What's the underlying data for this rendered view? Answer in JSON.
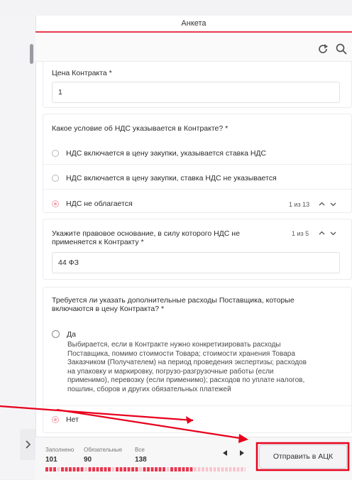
{
  "header": {
    "title": "Анкета"
  },
  "q1": {
    "label": "Цена Контракта *",
    "value": "1"
  },
  "q2": {
    "label": "Какое условие об НДС указывается в Контракте? *",
    "options": [
      "НДС включается в цену закупки, указывается ставка НДС",
      "НДС включается в цену закупки, ставка НДС не указывается",
      "НДС не облагается"
    ],
    "selected": 2,
    "counter": "1 из 13"
  },
  "q3": {
    "label_line1": "Укажите правовое основание, в силу которого НДС не",
    "label_line2": "применяется к Контракту *",
    "value": "44 ФЗ",
    "counter": "1 из 5"
  },
  "q4": {
    "label_line1": "Требуется ли указать дополнительные расходы Поставщика, которые",
    "label_line2": "включаются в цену Контракта? *",
    "option_yes": "Да",
    "yes_desc": [
      "Выбирается, если в Контракте нужно конкретизировать расходы",
      "Поставщика, помимо стоимости Товара; стоимости хранения Товара",
      "Заказчиком (Получателем) на период проведения экспертизы; расходов",
      "на упаковку и маркировку, погрузо-разгрузочные работы (если",
      "применимо), перевозку (если применимо); расходов по уплате налогов,",
      "пошлин, сборов и других обязательных платежей"
    ],
    "option_no": "Нет",
    "selected": "no"
  },
  "footer": {
    "filled_label": "Заполнено",
    "filled_value": "101",
    "required_label": "Обязательные",
    "required_value": "90",
    "all_label": "Все",
    "all_value": "138",
    "progress_fraction": 0.73,
    "send_label": "Отправить в АЦК"
  },
  "colors": {
    "accent": "#e8384f",
    "arrow": "#e8001c",
    "selected_radio": "#f2a6b2"
  }
}
